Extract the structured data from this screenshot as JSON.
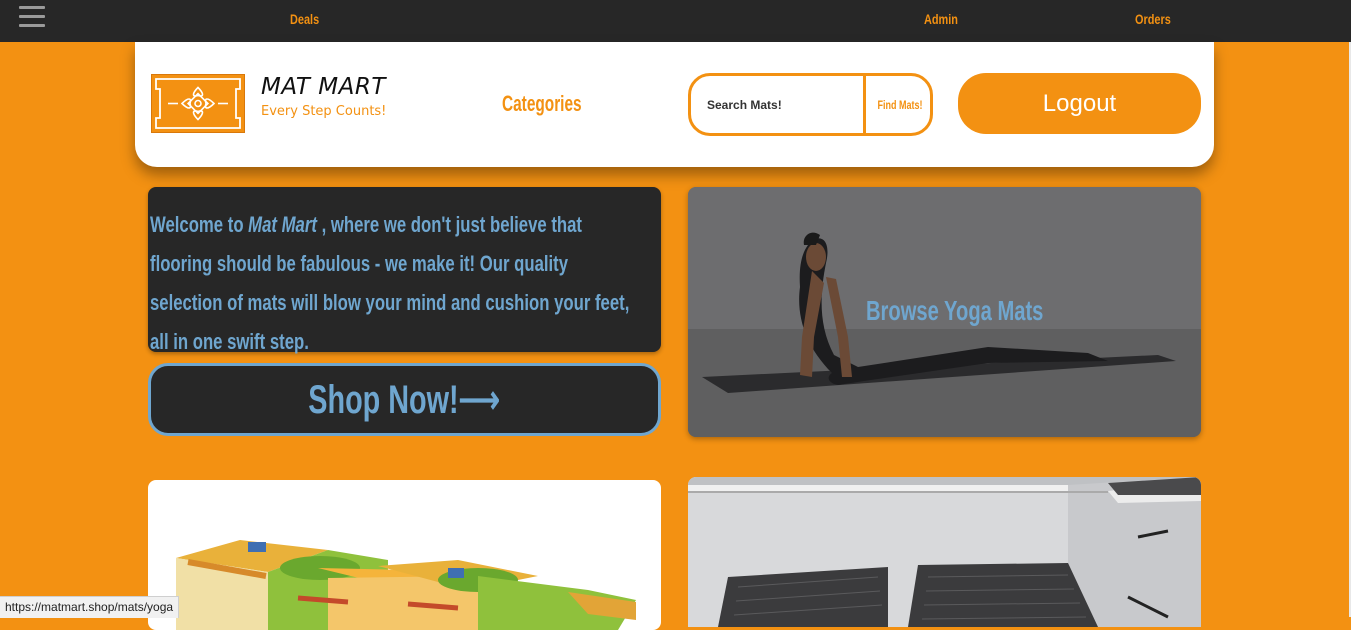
{
  "topbar": {
    "menu_icon": "hamburger-menu-icon",
    "links": {
      "deals": "Deals",
      "admin": "Admin",
      "orders": "Orders"
    }
  },
  "header": {
    "logo_icon": "ornament-logo-icon",
    "brand_title": "MAT MART",
    "brand_tagline": "Every Step Counts!",
    "categories_label": "Categories",
    "search": {
      "placeholder": "Search Mats!",
      "value": "",
      "button_label": "Find Mats!"
    },
    "logout_label": "Logout"
  },
  "hero": {
    "welcome_prefix": "Welcome to ",
    "welcome_brand": "Mat Mart",
    "welcome_suffix": " , where we don't just believe that flooring should be fabulous - we make it! Our quality selection of mats will blow your mind and cushion your feet, all in one swift step.",
    "shop_button_label": "Shop Now!⟶"
  },
  "cards": {
    "yoga_label": "Browse Yoga Mats"
  },
  "status_bar": {
    "url": "https://matmart.shop/mats/yoga"
  },
  "colors": {
    "accent": "#f39112",
    "dark": "#272727",
    "link_blue": "#6fa6cf",
    "white": "#ffffff"
  }
}
